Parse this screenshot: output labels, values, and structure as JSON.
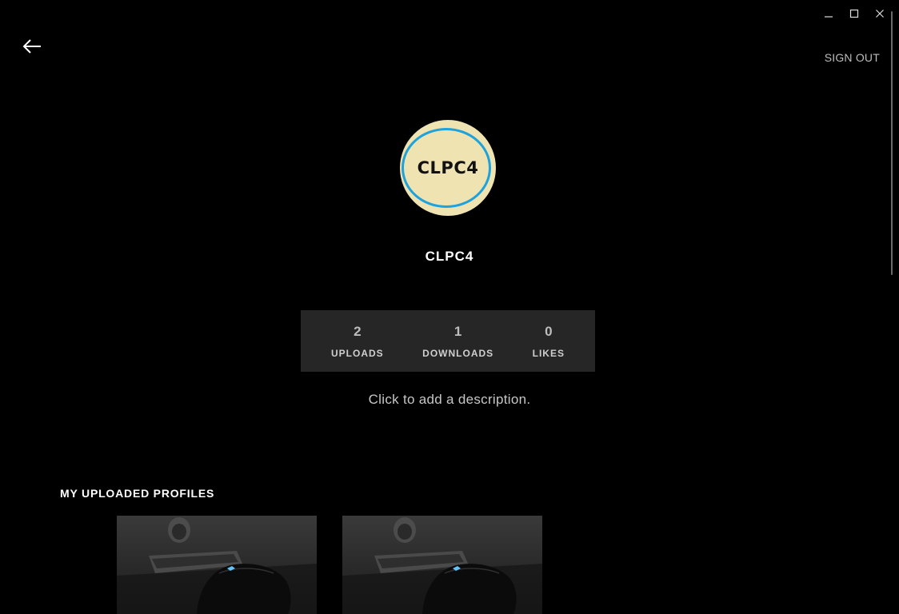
{
  "window": {
    "controls": {
      "minimize": "minimize-icon",
      "maximize": "maximize-icon",
      "close": "close-icon"
    }
  },
  "header": {
    "back_icon": "arrow-left-icon",
    "sign_out_label": "SIGN OUT"
  },
  "profile": {
    "avatar_text": "CLPC4",
    "username": "CLPC4",
    "description_placeholder": "Click to add a description.",
    "colors": {
      "avatar_bg": "#efe3b2",
      "avatar_ring": "#1ea2dc",
      "stats_bg": "#262626"
    }
  },
  "stats": [
    {
      "value": "2",
      "label": "UPLOADS"
    },
    {
      "value": "1",
      "label": "DOWNLOADS"
    },
    {
      "value": "0",
      "label": "LIKES"
    }
  ],
  "uploaded": {
    "title": "MY UPLOADED PROFILES",
    "items": [
      {
        "image": "gaming-mouse-keyboard-photo"
      },
      {
        "image": "gaming-mouse-keyboard-photo"
      }
    ]
  }
}
